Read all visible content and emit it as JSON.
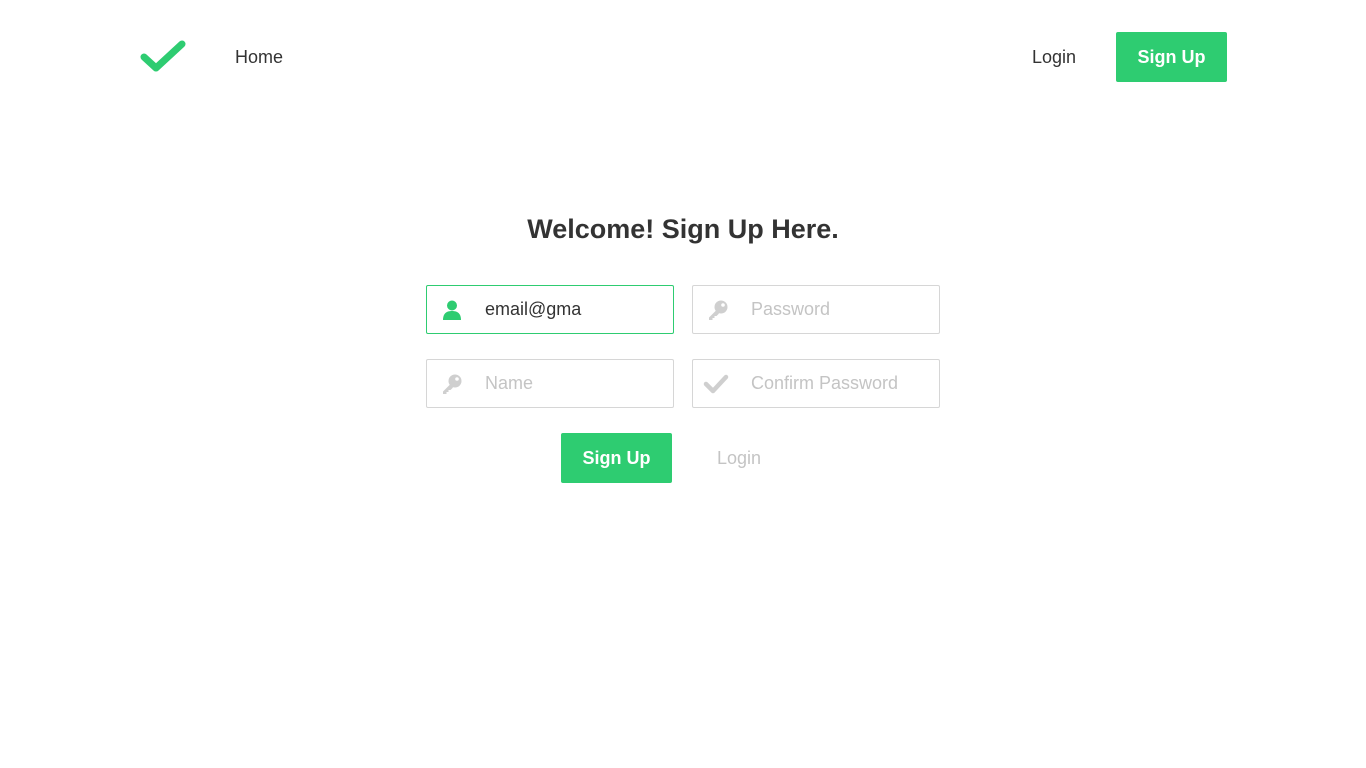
{
  "colors": {
    "accent": "#2ecc71",
    "text": "#333333",
    "muted": "#c4c4c4",
    "border": "#d6d6d6"
  },
  "nav": {
    "logo_icon": "checkmark-icon",
    "home_label": "Home",
    "login_label": "Login",
    "signup_label": "Sign Up"
  },
  "form": {
    "title": "Welcome! Sign Up Here.",
    "email": {
      "value": "email@gma",
      "icon": "user-icon"
    },
    "password": {
      "placeholder": "Password",
      "icon": "key-icon"
    },
    "name": {
      "placeholder": "Name",
      "icon": "key-icon"
    },
    "confirm_password": {
      "placeholder": "Confirm Password",
      "icon": "checkmark-icon"
    },
    "submit_label": "Sign Up",
    "login_link_label": "Login"
  }
}
